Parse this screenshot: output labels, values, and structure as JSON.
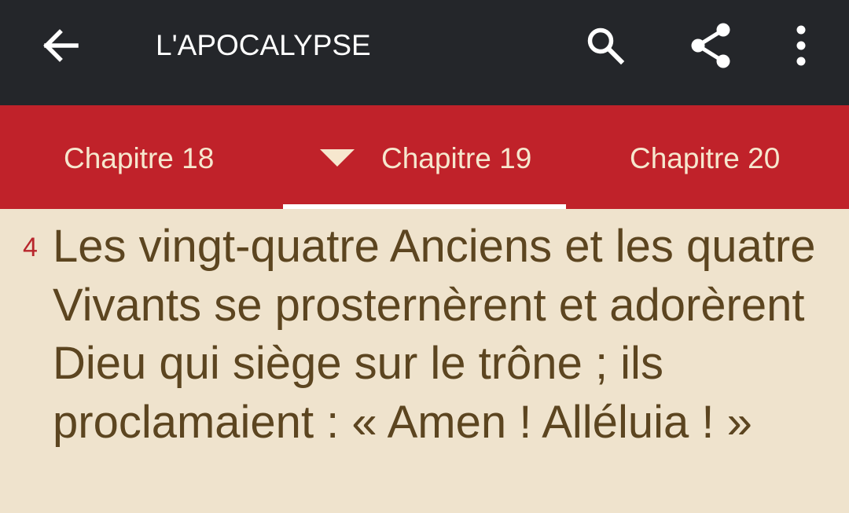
{
  "app_bar": {
    "title": "L'APOCALYPSE",
    "icons": {
      "back": "arrow-left-icon",
      "search": "search-icon",
      "share": "share-icon",
      "more": "more-vertical-icon"
    }
  },
  "tabs": {
    "previous": "Chapitre 18",
    "current": "Chapitre 19",
    "next": "Chapitre 20",
    "current_icon": "caret-down-icon"
  },
  "verse": {
    "number": "4",
    "text": "Les vingt-quatre Anciens et les quatre Vivants se prosternèrent et adorèrent Dieu qui siège sur le trône ; ils proclamaient : « Amen ! Alléluia ! »"
  },
  "colors": {
    "app_bar": "#24262a",
    "tab_bar": "#c0222a",
    "tab_text": "#f6e7ce",
    "page_background": "#efe3cd",
    "verse_text": "#5c4520",
    "verse_number": "#b8262c",
    "indicator": "#ffffff"
  }
}
